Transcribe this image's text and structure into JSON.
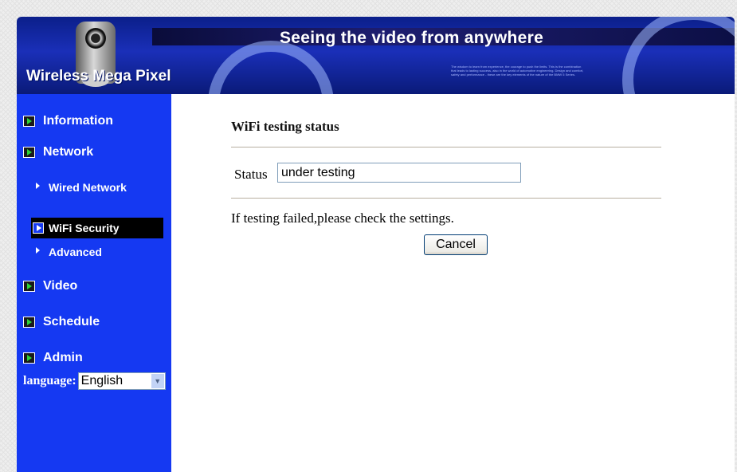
{
  "banner": {
    "slogan": "Seeing the video from anywhere",
    "brand": "Wireless Mega Pixel",
    "fine_print": "The wisdom to learn from experience, the courage to push the limits. This is the combination that leads to lasting success, also in the world of automotive engineering. Design and comfort, safety and performance - these are the key elements of the nature of the BMW 5 Series."
  },
  "sidebar": {
    "items": [
      {
        "label": "Information"
      },
      {
        "label": "Network"
      },
      {
        "label": "Video"
      },
      {
        "label": "Schedule"
      },
      {
        "label": "Admin"
      }
    ],
    "network_sub": [
      {
        "label": "Wired Network"
      },
      {
        "label": "WiFi Security",
        "active": true
      },
      {
        "label": "Advanced"
      }
    ],
    "language_label": "language:",
    "language_value": "English"
  },
  "main": {
    "heading": "WiFi testing status",
    "status_label": "Status",
    "status_value": "under testing",
    "message": "If testing failed,please check the settings.",
    "cancel_label": "Cancel"
  },
  "colors": {
    "sidebar_bg": "#1539f2",
    "active_item_bg": "#000000",
    "banner_bg": "#0b1f8a"
  }
}
